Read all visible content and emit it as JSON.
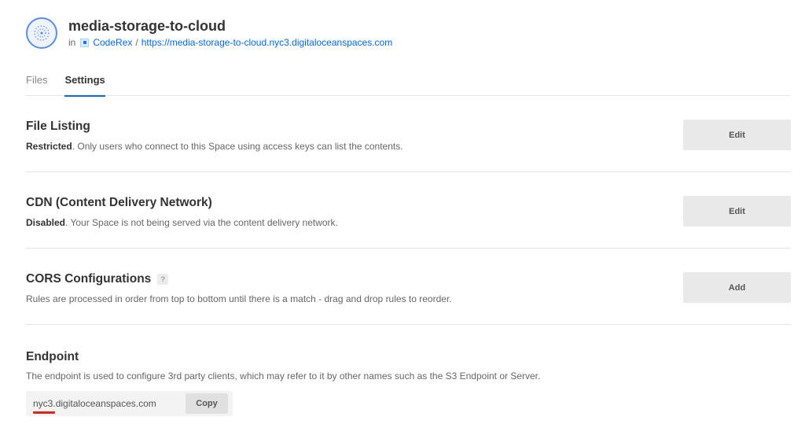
{
  "header": {
    "title": "media-storage-to-cloud",
    "in_label": "in",
    "project": "CodeRex",
    "separator": "/",
    "url": "https://media-storage-to-cloud.nyc3.digitaloceanspaces.com",
    "icon": "space-globe-icon",
    "project_icon": "project-square-icon"
  },
  "tabs": [
    {
      "label": "Files",
      "active": false
    },
    {
      "label": "Settings",
      "active": true
    }
  ],
  "sections": {
    "file_listing": {
      "title": "File Listing",
      "status": "Restricted",
      "description": ". Only users who connect to this Space using access keys can list the contents.",
      "button": "Edit"
    },
    "cdn": {
      "title": "CDN (Content Delivery Network)",
      "status": "Disabled",
      "description": ". Your Space is not being served via the content delivery network.",
      "button": "Edit"
    },
    "cors": {
      "title": "CORS Configurations",
      "help": "?",
      "description": "Rules are processed in order from top to bottom until there is a match - drag and drop rules to reorder.",
      "button": "Add"
    },
    "endpoint": {
      "title": "Endpoint",
      "description": "The endpoint is used to configure 3rd party clients, which may refer to it by other names such as the S3 Endpoint or Server.",
      "region": "nyc3",
      "domain": ".digitaloceanspaces.com",
      "copy_button": "Copy"
    }
  },
  "colors": {
    "accent": "#0069ff",
    "underline_annotation": "#e0261b"
  }
}
